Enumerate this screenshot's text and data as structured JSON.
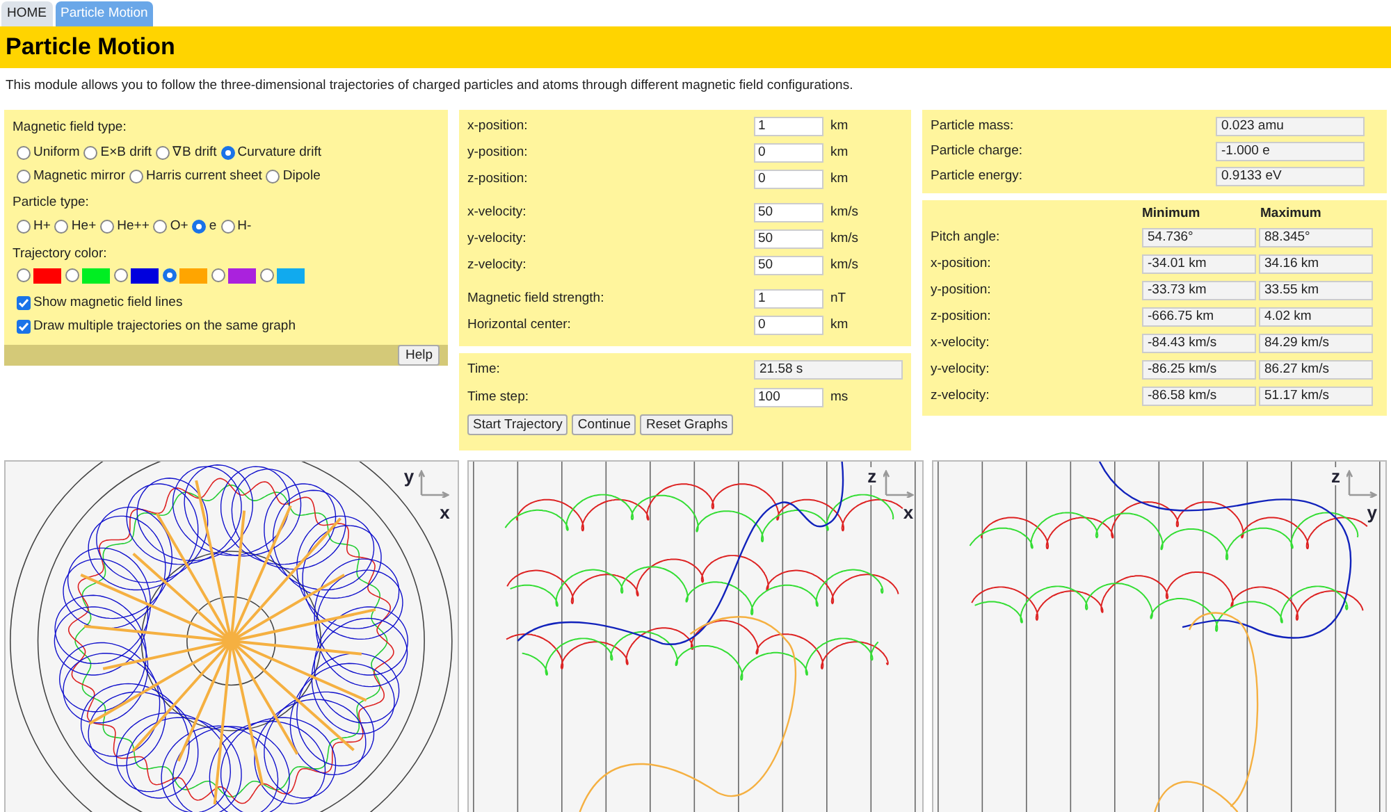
{
  "tabs": [
    {
      "label": "HOME",
      "selected": false
    },
    {
      "label": "Particle Motion",
      "selected": true
    }
  ],
  "title": "Particle Motion",
  "description": "This module allows you to follow the three-dimensional trajectories of charged particles and atoms through different magnetic field configurations.",
  "field_panel": {
    "field_type_label": "Magnetic field type:",
    "field_type_rows": [
      [
        {
          "label": "Uniform",
          "selected": false
        },
        {
          "label": "E×B drift",
          "selected": false
        },
        {
          "label": "∇B drift",
          "selected": false
        },
        {
          "label": "Curvature drift",
          "selected": true
        }
      ],
      [
        {
          "label": "Magnetic mirror",
          "selected": false
        },
        {
          "label": "Harris current sheet",
          "selected": false
        },
        {
          "label": "Dipole",
          "selected": false
        }
      ]
    ],
    "particle_type_label": "Particle type:",
    "particle_types": [
      {
        "label": "H+",
        "selected": false
      },
      {
        "label": "He+",
        "selected": false
      },
      {
        "label": "He++",
        "selected": false
      },
      {
        "label": "O+",
        "selected": false
      },
      {
        "label": "e",
        "selected": true
      },
      {
        "label": "H-",
        "selected": false
      }
    ],
    "color_label": "Trajectory color:",
    "colors": [
      {
        "color": "#ff0000",
        "selected": false
      },
      {
        "color": "#00ee22",
        "selected": false
      },
      {
        "color": "#0000dd",
        "selected": false
      },
      {
        "color": "#ffa500",
        "selected": true
      },
      {
        "color": "#aa22dd",
        "selected": false
      },
      {
        "color": "#11aaee",
        "selected": false
      }
    ],
    "checkboxes": [
      {
        "label": "Show magnetic field lines",
        "checked": true
      },
      {
        "label": "Draw multiple trajectories on the same graph",
        "checked": true
      }
    ],
    "help_button": "Help"
  },
  "input_groups": [
    [
      {
        "label": "x-position:",
        "value": "1",
        "unit": "km"
      },
      {
        "label": "y-position:",
        "value": "0",
        "unit": "km"
      },
      {
        "label": "z-position:",
        "value": "0",
        "unit": "km"
      }
    ],
    [
      {
        "label": "x-velocity:",
        "value": "50",
        "unit": "km/s"
      },
      {
        "label": "y-velocity:",
        "value": "50",
        "unit": "km/s"
      },
      {
        "label": "z-velocity:",
        "value": "50",
        "unit": "km/s"
      }
    ],
    [
      {
        "label": "Magnetic field strength:",
        "value": "1",
        "unit": "nT"
      },
      {
        "label": "Horizontal center:",
        "value": "0",
        "unit": "km"
      }
    ]
  ],
  "time_panel": {
    "time_label": "Time:",
    "time_value": "21.58 s",
    "step_label": "Time step:",
    "step_value": "100",
    "step_unit": "ms",
    "buttons": [
      "Start Trajectory",
      "Continue",
      "Reset Graphs"
    ]
  },
  "particle_info": [
    {
      "label": "Particle mass:",
      "value": "0.023 amu"
    },
    {
      "label": "Particle charge:",
      "value": "-1.000 e"
    },
    {
      "label": "Particle energy:",
      "value": "0.9133 eV"
    }
  ],
  "ranges": {
    "columns": [
      "Minimum",
      "Maximum"
    ],
    "rows": [
      {
        "label": "Pitch angle:",
        "min": "54.736°",
        "max": "88.345°"
      },
      {
        "label": "x-position:",
        "min": "-34.01 km",
        "max": "34.16 km"
      },
      {
        "label": "y-position:",
        "min": "-33.73 km",
        "max": "33.55 km"
      },
      {
        "label": "z-position:",
        "min": "-666.75 km",
        "max": "4.02 km"
      },
      {
        "label": "x-velocity:",
        "min": "-84.43 km/s",
        "max": "84.29 km/s"
      },
      {
        "label": "y-velocity:",
        "min": "-86.25 km/s",
        "max": "86.27 km/s"
      },
      {
        "label": "z-velocity:",
        "min": "-86.58 km/s",
        "max": "51.17 km/s"
      }
    ]
  },
  "plots": [
    {
      "kind": "polar",
      "vertical_axis": "y",
      "horizontal_axis": "x"
    },
    {
      "kind": "side",
      "vertical_axis": "z",
      "horizontal_axis": "x"
    },
    {
      "kind": "side",
      "vertical_axis": "z",
      "horizontal_axis": "y"
    }
  ]
}
